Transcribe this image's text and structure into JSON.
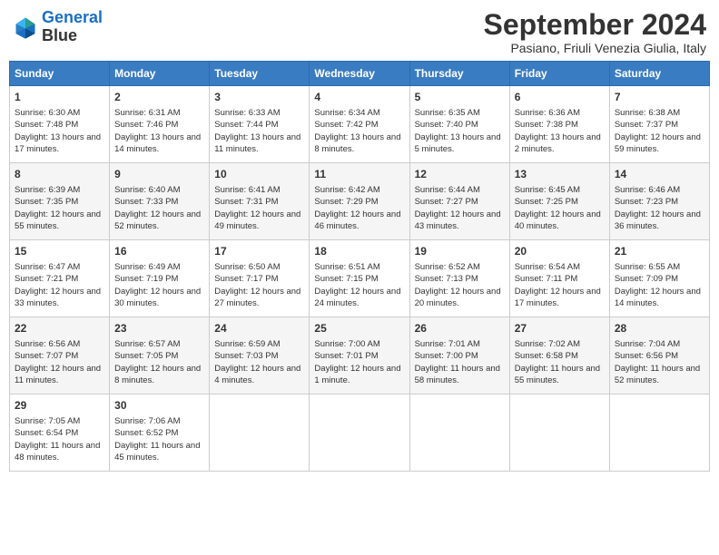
{
  "logo": {
    "line1": "General",
    "line2": "Blue"
  },
  "title": "September 2024",
  "location": "Pasiano, Friuli Venezia Giulia, Italy",
  "days_of_week": [
    "Sunday",
    "Monday",
    "Tuesday",
    "Wednesday",
    "Thursday",
    "Friday",
    "Saturday"
  ],
  "weeks": [
    [
      {
        "day": "1",
        "sunrise": "6:30 AM",
        "sunset": "7:48 PM",
        "daylight": "13 hours and 17 minutes."
      },
      {
        "day": "2",
        "sunrise": "6:31 AM",
        "sunset": "7:46 PM",
        "daylight": "13 hours and 14 minutes."
      },
      {
        "day": "3",
        "sunrise": "6:33 AM",
        "sunset": "7:44 PM",
        "daylight": "13 hours and 11 minutes."
      },
      {
        "day": "4",
        "sunrise": "6:34 AM",
        "sunset": "7:42 PM",
        "daylight": "13 hours and 8 minutes."
      },
      {
        "day": "5",
        "sunrise": "6:35 AM",
        "sunset": "7:40 PM",
        "daylight": "13 hours and 5 minutes."
      },
      {
        "day": "6",
        "sunrise": "6:36 AM",
        "sunset": "7:38 PM",
        "daylight": "13 hours and 2 minutes."
      },
      {
        "day": "7",
        "sunrise": "6:38 AM",
        "sunset": "7:37 PM",
        "daylight": "12 hours and 59 minutes."
      }
    ],
    [
      {
        "day": "8",
        "sunrise": "6:39 AM",
        "sunset": "7:35 PM",
        "daylight": "12 hours and 55 minutes."
      },
      {
        "day": "9",
        "sunrise": "6:40 AM",
        "sunset": "7:33 PM",
        "daylight": "12 hours and 52 minutes."
      },
      {
        "day": "10",
        "sunrise": "6:41 AM",
        "sunset": "7:31 PM",
        "daylight": "12 hours and 49 minutes."
      },
      {
        "day": "11",
        "sunrise": "6:42 AM",
        "sunset": "7:29 PM",
        "daylight": "12 hours and 46 minutes."
      },
      {
        "day": "12",
        "sunrise": "6:44 AM",
        "sunset": "7:27 PM",
        "daylight": "12 hours and 43 minutes."
      },
      {
        "day": "13",
        "sunrise": "6:45 AM",
        "sunset": "7:25 PM",
        "daylight": "12 hours and 40 minutes."
      },
      {
        "day": "14",
        "sunrise": "6:46 AM",
        "sunset": "7:23 PM",
        "daylight": "12 hours and 36 minutes."
      }
    ],
    [
      {
        "day": "15",
        "sunrise": "6:47 AM",
        "sunset": "7:21 PM",
        "daylight": "12 hours and 33 minutes."
      },
      {
        "day": "16",
        "sunrise": "6:49 AM",
        "sunset": "7:19 PM",
        "daylight": "12 hours and 30 minutes."
      },
      {
        "day": "17",
        "sunrise": "6:50 AM",
        "sunset": "7:17 PM",
        "daylight": "12 hours and 27 minutes."
      },
      {
        "day": "18",
        "sunrise": "6:51 AM",
        "sunset": "7:15 PM",
        "daylight": "12 hours and 24 minutes."
      },
      {
        "day": "19",
        "sunrise": "6:52 AM",
        "sunset": "7:13 PM",
        "daylight": "12 hours and 20 minutes."
      },
      {
        "day": "20",
        "sunrise": "6:54 AM",
        "sunset": "7:11 PM",
        "daylight": "12 hours and 17 minutes."
      },
      {
        "day": "21",
        "sunrise": "6:55 AM",
        "sunset": "7:09 PM",
        "daylight": "12 hours and 14 minutes."
      }
    ],
    [
      {
        "day": "22",
        "sunrise": "6:56 AM",
        "sunset": "7:07 PM",
        "daylight": "12 hours and 11 minutes."
      },
      {
        "day": "23",
        "sunrise": "6:57 AM",
        "sunset": "7:05 PM",
        "daylight": "12 hours and 8 minutes."
      },
      {
        "day": "24",
        "sunrise": "6:59 AM",
        "sunset": "7:03 PM",
        "daylight": "12 hours and 4 minutes."
      },
      {
        "day": "25",
        "sunrise": "7:00 AM",
        "sunset": "7:01 PM",
        "daylight": "12 hours and 1 minute."
      },
      {
        "day": "26",
        "sunrise": "7:01 AM",
        "sunset": "7:00 PM",
        "daylight": "11 hours and 58 minutes."
      },
      {
        "day": "27",
        "sunrise": "7:02 AM",
        "sunset": "6:58 PM",
        "daylight": "11 hours and 55 minutes."
      },
      {
        "day": "28",
        "sunrise": "7:04 AM",
        "sunset": "6:56 PM",
        "daylight": "11 hours and 52 minutes."
      }
    ],
    [
      {
        "day": "29",
        "sunrise": "7:05 AM",
        "sunset": "6:54 PM",
        "daylight": "11 hours and 48 minutes."
      },
      {
        "day": "30",
        "sunrise": "7:06 AM",
        "sunset": "6:52 PM",
        "daylight": "11 hours and 45 minutes."
      },
      null,
      null,
      null,
      null,
      null
    ]
  ]
}
